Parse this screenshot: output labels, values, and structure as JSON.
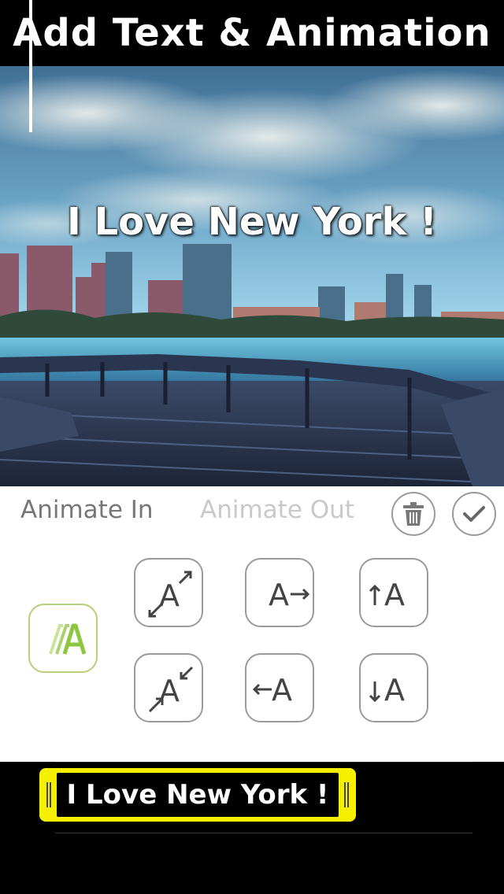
{
  "banner": {
    "title": "Add Text & Animation"
  },
  "canvas": {
    "overlay_text": "I Love New York !"
  },
  "panel": {
    "tabs": [
      {
        "label": "Animate In",
        "selected": true
      },
      {
        "label": "Animate Out",
        "selected": false
      }
    ],
    "actions": [
      {
        "icon": "trash-icon"
      },
      {
        "icon": "checkmark-icon"
      }
    ],
    "selected_animation_icon": "fade-in-icon",
    "animations": [
      {
        "icon": "zoom-out-icon",
        "glyph": "A"
      },
      {
        "icon": "slide-right-icon",
        "glyph": "A"
      },
      {
        "icon": "slide-up-icon",
        "glyph": "A"
      },
      {
        "icon": "zoom-in-icon",
        "glyph": "A"
      },
      {
        "icon": "slide-left-icon",
        "glyph": "A"
      },
      {
        "icon": "slide-down-icon",
        "glyph": "A"
      }
    ],
    "colors": {
      "accent_green": "#8cc63f",
      "border_gray": "#9a9a9a"
    }
  },
  "timeline": {
    "clip_text": "I Love New York !",
    "clip_color": "#f5f000"
  }
}
